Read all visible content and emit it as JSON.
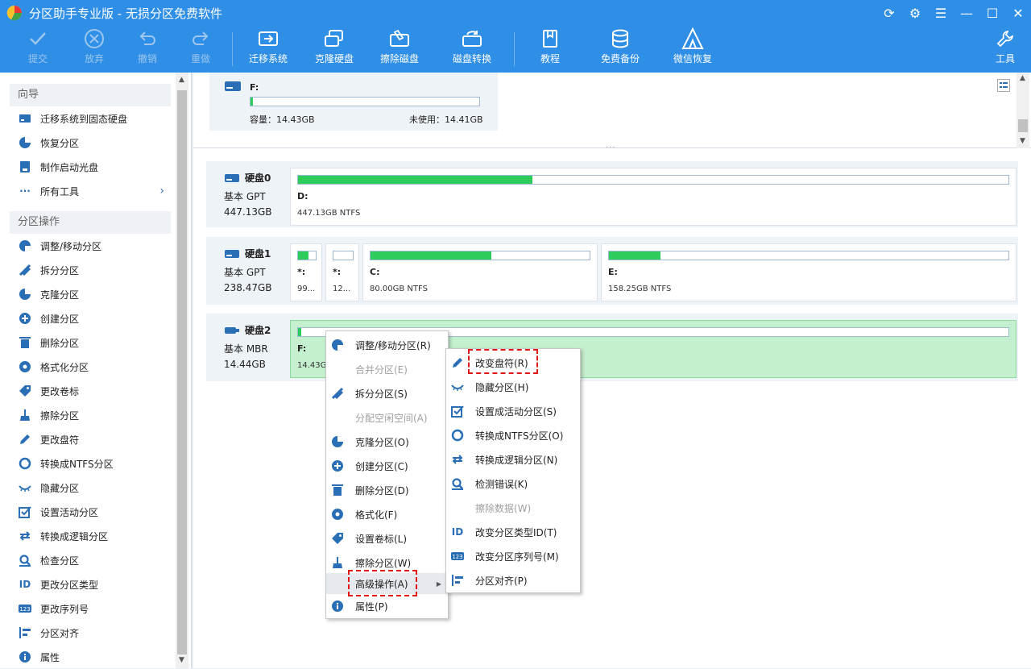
{
  "app": {
    "title": "分区助手专业版 - 无损分区免费软件"
  },
  "toolbar": {
    "commit": "提交",
    "discard": "放弃",
    "undo": "撤销",
    "redo": "重做",
    "migrate": "迁移系统",
    "clone": "克隆硬盘",
    "wipe": "擦除磁盘",
    "convert": "磁盘转换",
    "tutorial": "教程",
    "backup": "免费备份",
    "wechat": "微信恢复",
    "tools": "工具"
  },
  "sidebar": {
    "wizard_title": "向导",
    "wizard_items": [
      "迁移系统到固态硬盘",
      "恢复分区",
      "制作启动光盘",
      "所有工具"
    ],
    "ops_title": "分区操作",
    "ops_items": [
      "调整/移动分区",
      "拆分分区",
      "克隆分区",
      "创建分区",
      "删除分区",
      "格式化分区",
      "更改卷标",
      "擦除分区",
      "更改盘符",
      "转换成NTFS分区",
      "隐藏分区",
      "设置活动分区",
      "转换成逻辑分区",
      "检查分区",
      "更改分区类型",
      "更改序列号",
      "分区对齐",
      "属性"
    ]
  },
  "top_partition": {
    "label": "F:",
    "capacity": "容量：14.43GB",
    "unused": "未使用：14.41GB",
    "used_fraction": 0.01
  },
  "disks": [
    {
      "name": "硬盘0",
      "type": "基本 GPT",
      "size": "447.13GB",
      "partitions": [
        {
          "label": "D:",
          "info": "447.13GB NTFS",
          "used": 0.33
        }
      ]
    },
    {
      "name": "硬盘1",
      "type": "基本 GPT",
      "size": "238.47GB",
      "partitions": [
        {
          "label": "*:",
          "info": "99...",
          "used": 0.6
        },
        {
          "label": "*:",
          "info": "12...",
          "used": 0.0
        },
        {
          "label": "C:",
          "info": "80.00GB NTFS",
          "used": 0.55
        },
        {
          "label": "E:",
          "info": "158.25GB NTFS",
          "used": 0.13
        }
      ]
    },
    {
      "name": "硬盘2",
      "type": "基本 MBR",
      "size": "14.44GB",
      "partitions": [
        {
          "label": "F:",
          "info": "14.43GB",
          "used": 0.005
        }
      ]
    }
  ],
  "context_menu": {
    "items": [
      "调整/移动分区(R)",
      "合并分区(E)",
      "拆分分区(S)",
      "分配空闲空间(A)",
      "克隆分区(O)",
      "创建分区(C)",
      "删除分区(D)",
      "格式化(F)",
      "设置卷标(L)",
      "擦除分区(W)",
      "高级操作(A)",
      "属性(P)"
    ]
  },
  "submenu": {
    "items": [
      "改变盘符(R)",
      "隐藏分区(H)",
      "设置成活动分区(S)",
      "转换成NTFS分区(O)",
      "转换成逻辑分区(N)",
      "检测错误(K)",
      "擦除数据(W)",
      "改变分区类型ID(T)",
      "改变分区序列号(M)",
      "分区对齐(P)"
    ]
  },
  "colors": {
    "accent": "#2f8ee5",
    "used_bar": "#2ecc5a",
    "selected_partition": "#c5f0cf",
    "highlight": "#e01818"
  }
}
